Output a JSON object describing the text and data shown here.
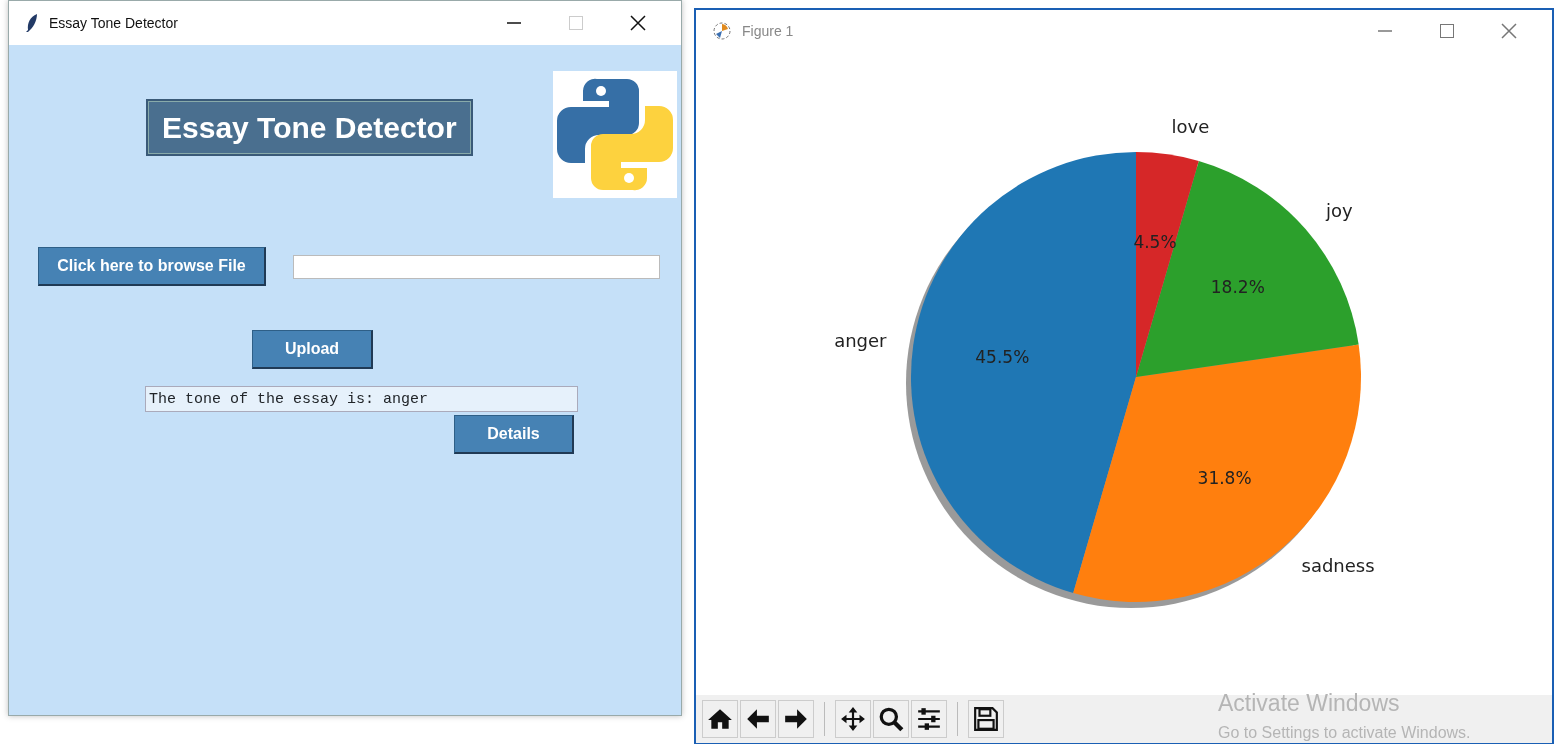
{
  "tone_window": {
    "title": "Essay Tone Detector",
    "heading": "Essay Tone Detector",
    "browse_button": "Click here to browse File",
    "upload_button": "Upload",
    "result": "The tone of the essay is: anger",
    "details_button": "Details"
  },
  "figure_window": {
    "title": "Figure 1",
    "chart_data": {
      "type": "pie",
      "categories": [
        "anger",
        "sadness",
        "joy",
        "love"
      ],
      "values": [
        45.5,
        31.8,
        18.2,
        4.5
      ],
      "colors": [
        "#1f77b4",
        "#ff7f0e",
        "#2ca02c",
        "#d62728"
      ],
      "value_labels": [
        "45.5%",
        "31.8%",
        "18.2%",
        "4.5%"
      ]
    },
    "toolbar": [
      {
        "kind": "home"
      },
      {
        "kind": "back"
      },
      {
        "kind": "forward"
      },
      {
        "kind": "separator"
      },
      {
        "kind": "pan"
      },
      {
        "kind": "zoom"
      },
      {
        "kind": "configure"
      },
      {
        "kind": "separator"
      },
      {
        "kind": "save"
      }
    ]
  },
  "activation_notice": {
    "title": "Activate Windows",
    "text": "Go to Settings to activate Windows."
  }
}
